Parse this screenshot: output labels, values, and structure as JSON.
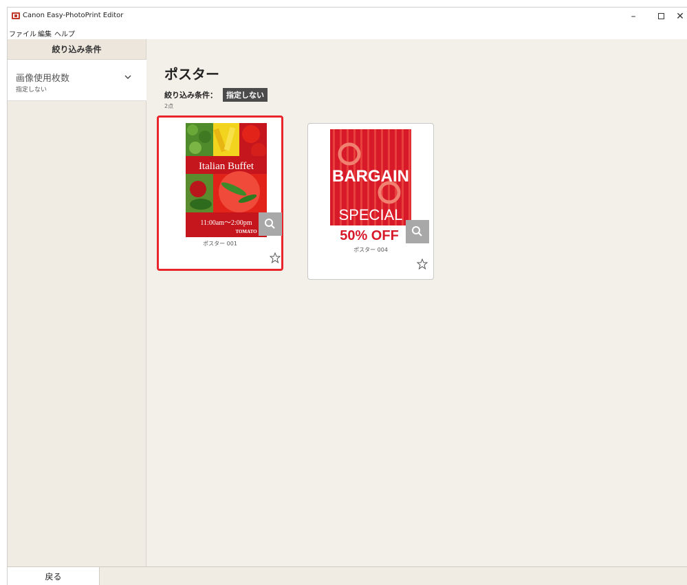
{
  "window": {
    "title": "Canon Easy-PhotoPrint Editor"
  },
  "menu": {
    "items": [
      "ファイル",
      "編集",
      "ヘルプ"
    ]
  },
  "sidebar": {
    "header": "絞り込み条件",
    "filter": {
      "name": "画像使用枚数",
      "value": "指定しない"
    }
  },
  "main": {
    "title": "ポスター",
    "filter_label": "絞り込み条件：",
    "filter_value": "指定しない",
    "count": "2点"
  },
  "cards": [
    {
      "name": "ポスター 001",
      "selected": true,
      "poster": {
        "headline": "Italian Buffet",
        "time": "11:00am～2:00pm",
        "place": "TOMATO"
      }
    },
    {
      "name": "ポスター 004",
      "selected": false,
      "poster": {
        "line1": "BARGAIN",
        "line2": "SPECIAL",
        "line3": "50% OFF"
      }
    }
  ],
  "footer": {
    "back_label": "戻る"
  },
  "colors": {
    "selection": "#e8252b",
    "poster_red": "#d7192a",
    "background": "#f3efe9"
  }
}
